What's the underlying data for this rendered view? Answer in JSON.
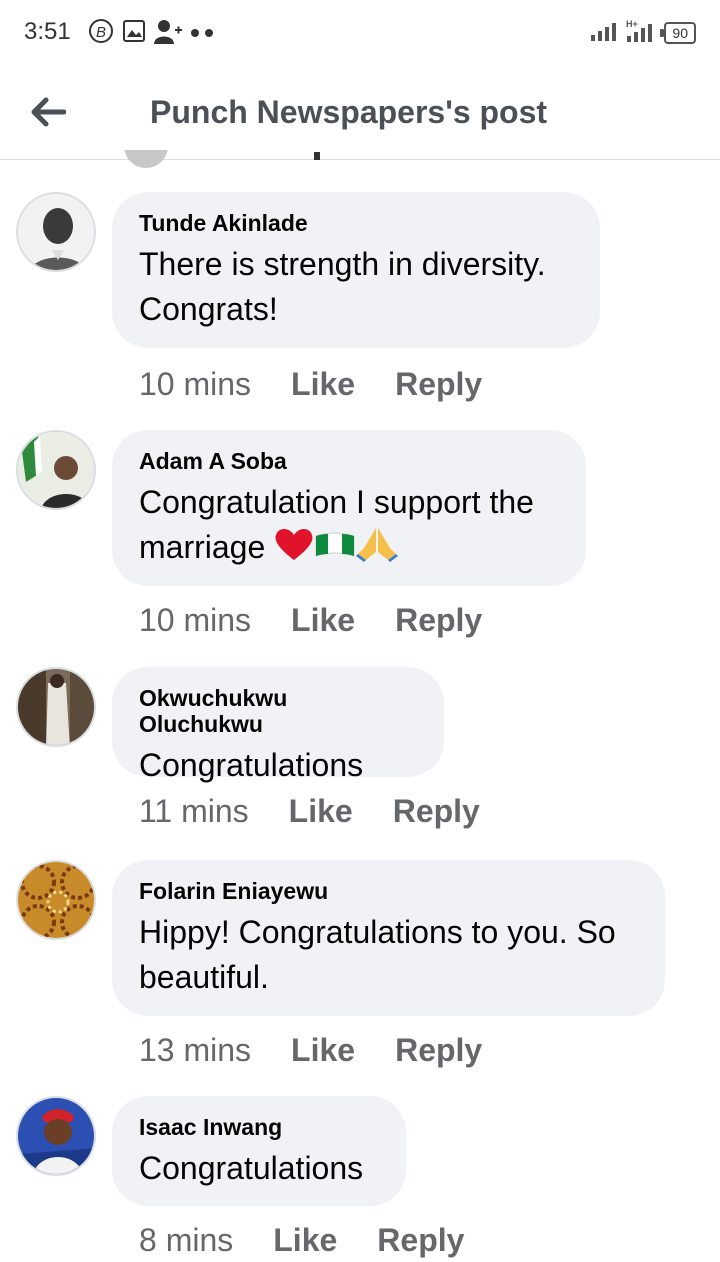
{
  "status_bar": {
    "time": "3:51",
    "battery": "90",
    "network": "H+"
  },
  "header": {
    "title": "Punch Newspapers's post"
  },
  "actions": {
    "like_label": "Like",
    "reply_label": "Reply"
  },
  "comments": [
    {
      "author": "Tunde Akinlade",
      "lines": [
        "There is strength in diversity.",
        "Congrats!"
      ],
      "time": "10 mins"
    },
    {
      "author": "Adam A Soba",
      "lines": [
        "Congratulation I support the",
        "marriage"
      ],
      "emojis": [
        "red-heart",
        "nigeria-flag",
        "folded-hands"
      ],
      "time": "10 mins"
    },
    {
      "author": "Okwuchukwu Oluchukwu",
      "lines": [
        "Congratulations"
      ],
      "time": "11 mins"
    },
    {
      "author": "Folarin Eniayewu",
      "lines": [
        "Hippy! Congratulations to you. So",
        "beautiful."
      ],
      "time": "13 mins"
    },
    {
      "author": "Isaac Inwang",
      "lines": [
        "Congratulations"
      ],
      "time": "8 mins"
    }
  ],
  "colors": {
    "bubble": "#f0f2f5",
    "meta_text": "#65676b",
    "title": "#4b4f56"
  }
}
